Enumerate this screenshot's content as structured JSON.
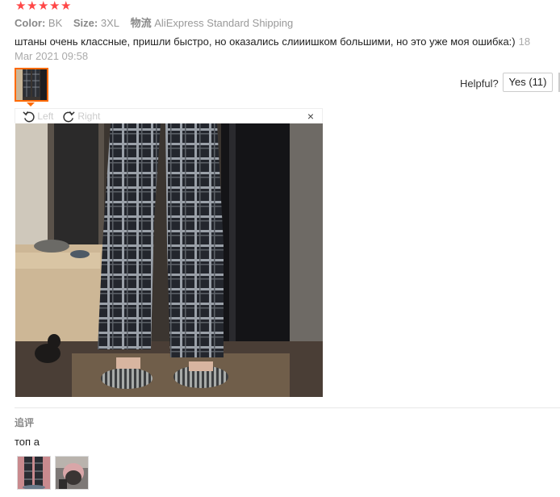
{
  "review": {
    "rating": 5,
    "stars": [
      "★",
      "★",
      "★",
      "★",
      "★"
    ],
    "color_label": "Color:",
    "color_value": "BK",
    "size_label": "Size:",
    "size_value": "3XL",
    "shipping_label": "物流",
    "shipping_value": "AliExpress Standard Shipping",
    "text": "штаны очень классные, пришли быстро, но оказались слииишком большими, но это уже моя ошибка:)",
    "date": "18 Mar 2021 09:58"
  },
  "helpful": {
    "label": "Helpful?",
    "yes_label": "Yes (11)"
  },
  "viewer": {
    "rotate_left_label": "Left",
    "rotate_right_label": "Right",
    "close_glyph": "×"
  },
  "additional": {
    "label": "追评",
    "text": "топ а"
  },
  "colors": {
    "star": "#ff4747",
    "selected_thumb_border": "#ff6a00",
    "muted_text": "#999999"
  }
}
